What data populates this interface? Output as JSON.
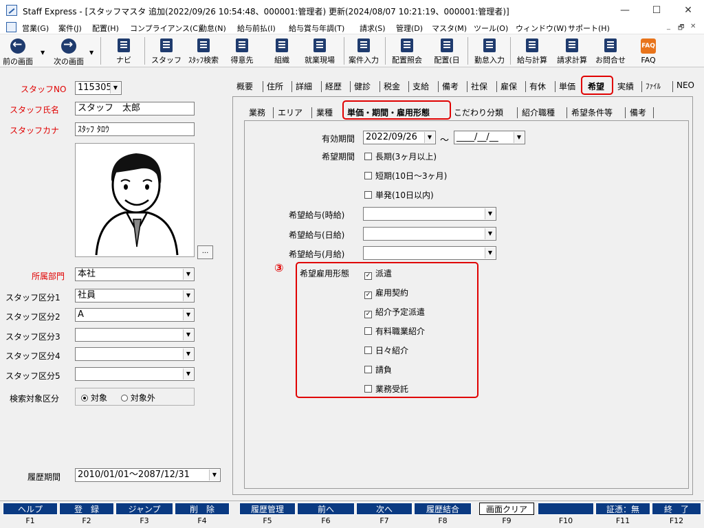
{
  "window": {
    "title": "Staff Express - [スタッフマスタ 追加(2022/09/26 10:54:48、000001:管理者) 更新(2024/08/07 10:21:19、000001:管理者)]",
    "min": "—",
    "max": "☐",
    "close": "✕"
  },
  "menu": [
    "営業(G)",
    "案件(J)",
    "配置(H)",
    "コンプライアンス(C)",
    "勤怠(N)",
    "給与前払(I)",
    "給与賞与年調(T)",
    "請求(S)",
    "管理(D)",
    "マスタ(M)",
    "ツール(O)",
    "ウィンドウ(W)",
    "サポート(H)"
  ],
  "mdi_controls": {
    "min": "_",
    "restore": "🗗",
    "close": "✕"
  },
  "toolbar": {
    "prev": "前の画面",
    "next": "次の画面",
    "nav": "ナビ",
    "staff": "スタッフ",
    "staff_search": "ｽﾀｯﾌ検索",
    "client": "得意先",
    "org": "組織",
    "site": "就業現場",
    "job_entry": "案件入力",
    "placement_inquiry": "配置照会",
    "placement_day": "配置(日",
    "attendance": "勤怠入力",
    "payroll": "給与計算",
    "billing": "請求計算",
    "inquiry": "お問合せ",
    "faq": "FAQ",
    "faq_icon": "FAQ"
  },
  "staff": {
    "no_label": "スタッフNO",
    "no_value": "115305",
    "name_label": "スタッフ氏名",
    "name_value": "スタッフ　太郎",
    "kana_label": "スタッフカナ",
    "kana_value": "ｽﾀｯﾌ ﾀﾛｳ",
    "photo_button": "...",
    "dept_label": "所属部門",
    "dept_value": "本社",
    "cat1_label": "スタッフ区分1",
    "cat1_value": "社員",
    "cat2_label": "スタッフ区分2",
    "cat2_value": "A",
    "cat3_label": "スタッフ区分3",
    "cat3_value": "",
    "cat4_label": "スタッフ区分4",
    "cat4_value": "",
    "cat5_label": "スタッフ区分5",
    "cat5_value": "",
    "search_label": "検索対象区分",
    "search_on": "対象",
    "search_off": "対象外",
    "history_label": "履歴期間",
    "history_value": "2010/01/01～2087/12/31"
  },
  "main_tabs": [
    "概要",
    "住所",
    "詳細",
    "経歴",
    "健診",
    "税金",
    "支給",
    "備考",
    "社保",
    "雇保",
    "有休",
    "単価",
    "希望",
    "実績",
    "ﾌｧｲﾙ",
    "NEO"
  ],
  "sub_tabs": [
    "業務",
    "エリア",
    "業種",
    "単価・期間・雇用形態",
    "こだわり分類",
    "紹介職種",
    "希望条件等",
    "備考"
  ],
  "form": {
    "valid_label": "有効期間",
    "valid_from": "2022/09/26",
    "valid_to": "____/__/__",
    "tilde": "～",
    "period_label": "希望期間",
    "period_long": "長期(3ヶ月以上)",
    "period_short": "短期(10日～3ヶ月)",
    "period_single": "単発(10日以内)",
    "wage_hour_label": "希望給与(時給)",
    "wage_day_label": "希望給与(日給)",
    "wage_month_label": "希望給与(月給)",
    "employment_label": "希望雇用形態",
    "emp_dispatch": "派遣",
    "emp_contract": "雇用契約",
    "emp_ttp": "紹介予定派遣",
    "emp_paid_intro": "有料職業紹介",
    "emp_daily": "日々紹介",
    "emp_contracting": "請負",
    "emp_outsourcing": "業務受託",
    "annotation": "③"
  },
  "fkeys": [
    {
      "label": "ヘルプ",
      "key": "F1"
    },
    {
      "label": "登　録",
      "key": "F2"
    },
    {
      "label": "ジャンプ",
      "key": "F3"
    },
    {
      "label": "削　除",
      "key": "F4"
    },
    {
      "label": "履歴管理",
      "key": "F5"
    },
    {
      "label": "前へ",
      "key": "F6"
    },
    {
      "label": "次へ",
      "key": "F7"
    },
    {
      "label": "履歴結合",
      "key": "F8"
    },
    {
      "label": "画面クリア",
      "key": "F9"
    },
    {
      "label": "",
      "key": "F10"
    },
    {
      "label": "証憑：無",
      "key": "F11"
    },
    {
      "label": "終　了",
      "key": "F12"
    }
  ]
}
